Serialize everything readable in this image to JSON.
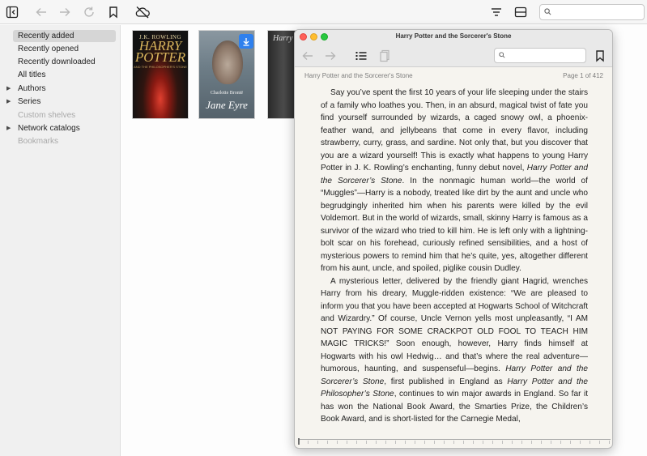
{
  "toolbar": {
    "icons": [
      "sidebar-toggle-icon",
      "back-arrow-icon",
      "forward-arrow-icon",
      "reload-icon",
      "bookmark-icon",
      "cloud-off-icon",
      "sort-icon",
      "layout-icon",
      "search-icon"
    ],
    "search_placeholder": ""
  },
  "sidebar": {
    "items": [
      {
        "label": "Recently added"
      },
      {
        "label": "Recently opened"
      },
      {
        "label": "Recently downloaded"
      },
      {
        "label": "All titles"
      },
      {
        "label": "Authors"
      },
      {
        "label": "Series"
      },
      {
        "label": "Custom shelves"
      },
      {
        "label": "Network catalogs"
      },
      {
        "label": "Bookmarks"
      }
    ]
  },
  "library": {
    "books": [
      {
        "author": "J.K. ROWLING",
        "title": "HARRY POTTER",
        "subtitle": "AND THE PHILOSOPHER'S STONE"
      },
      {
        "author": "Charlotte Brontë",
        "title": "Jane Eyre",
        "badge": "download-icon"
      },
      {
        "title": "Harry"
      }
    ]
  },
  "reader": {
    "window_title": "Harry Potter and the Sorcerer's Stone",
    "search_placeholder": "",
    "header_title": "Harry Potter and the Sorcerer's Stone",
    "page_indicator": "Page 1 of 412",
    "p1_a": "Say you’ve spent the first 10 years of your life sleeping under the stairs of a family who loathes you. Then, in an absurd, magical twist of fate you find yourself surrounded by wizards, a caged snowy owl, a phoenix-feather wand, and jellybeans that come in every flavor, including strawberry, curry, grass, and sardine. Not only that, but you discover that you are a wizard yourself! This is exactly what happens to young Harry Potter in J. K. Rowling’s enchanting, funny debut novel, ",
    "p1_em": "Harry Potter and the Sorcerer’s Stone",
    "p1_b": ". In the nonmagic human world—the world of “Muggles”—Harry is a nobody, treated like dirt by the aunt and uncle who begrudgingly inherited him when his parents were killed by the evil Voldemort. But in the world of wizards, small, skinny Harry is famous as a survivor of the wizard who tried to kill him. He is left only with a lightning-bolt scar on his forehead, curiously refined sensibilities, and a host of mysterious powers to remind him that he’s quite, yes, altogether different from his aunt, uncle, and spoiled, piglike cousin Dudley.",
    "p2_a": "A mysterious letter, delivered by the friendly giant Hagrid, wrenches Harry from his dreary, Muggle-ridden existence: “We are pleased to inform you that you have been accepted at Hogwarts School of Witchcraft and Wizardry.” Of course, Uncle Vernon yells most unpleasantly, “I AM NOT PAYING FOR SOME CRACKPOT OLD FOOL TO TEACH HIM MAGIC TRICKS!” Soon enough, however, Harry finds himself at Hogwarts with his owl Hedwig… and that’s where the real adventure—humorous, haunting, and suspenseful—begins. ",
    "p2_em1": "Harry Potter and the Sorcerer’s Stone",
    "p2_b": ", first published in England as ",
    "p2_em2": "Harry Potter and the Philosopher’s Stone",
    "p2_c": ", continues to win major awards in England. So far it has won the National Book Award, the Smarties Prize, the Children’s Book Award, and is short-listed for the Carnegie Medal,"
  }
}
